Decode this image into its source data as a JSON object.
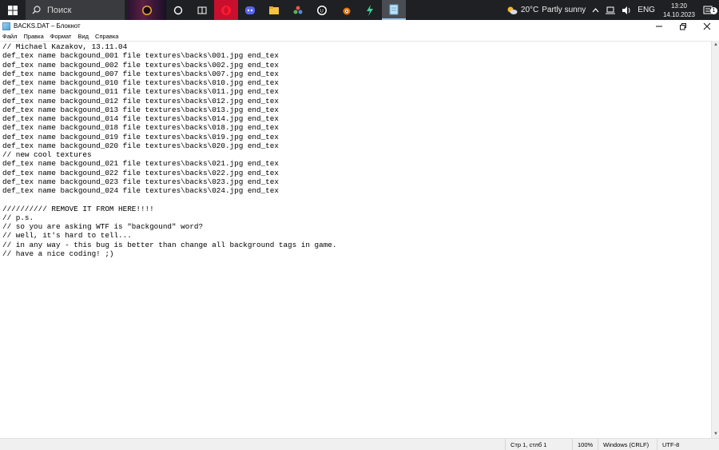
{
  "taskbar": {
    "search_label": "Поиск",
    "weather": {
      "temp": "20°C",
      "condition": "Partly sunny"
    },
    "language": "ENG",
    "time": "13:20",
    "date": "14.10.2023",
    "notification_count": "1",
    "apps": [
      "task-view-icon",
      "widgets-icon",
      "opera-icon",
      "discord-icon",
      "file-explorer-icon",
      "davinci-icon",
      "unreal-engine-icon",
      "blender-icon",
      "app-bolt-icon",
      "notepad-icon"
    ]
  },
  "window": {
    "title": "BACKS.DAT – Блокнот"
  },
  "menu": {
    "file": "Файл",
    "edit": "Правка",
    "format": "Формат",
    "view": "Вид",
    "help": "Справка"
  },
  "editor": {
    "lines": [
      "// Michael Kazakov, 13.11.04",
      "def_tex name backgound_001 file textures\\backs\\001.jpg end_tex",
      "def_tex name backgound_002 file textures\\backs\\002.jpg end_tex",
      "def_tex name backgound_007 file textures\\backs\\007.jpg end_tex",
      "def_tex name backgound_010 file textures\\backs\\010.jpg end_tex",
      "def_tex name backgound_011 file textures\\backs\\011.jpg end_tex",
      "def_tex name backgound_012 file textures\\backs\\012.jpg end_tex",
      "def_tex name backgound_013 file textures\\backs\\013.jpg end_tex",
      "def_tex name backgound_014 file textures\\backs\\014.jpg end_tex",
      "def_tex name backgound_018 file textures\\backs\\018.jpg end_tex",
      "def_tex name backgound_019 file textures\\backs\\019.jpg end_tex",
      "def_tex name backgound_020 file textures\\backs\\020.jpg end_tex",
      "// new cool textures",
      "def_tex name backgound_021 file textures\\backs\\021.jpg end_tex",
      "def_tex name backgound_022 file textures\\backs\\022.jpg end_tex",
      "def_tex name backgound_023 file textures\\backs\\023.jpg end_tex",
      "def_tex name backgound_024 file textures\\backs\\024.jpg end_tex",
      "",
      "////////// REMOVE IT FROM HERE!!!!",
      "// p.s.",
      "// so you are asking WTF is \"backgound\" word?",
      "// well, it's hard to tell...",
      "// in any way - this bug is better than change all background tags in game.",
      "// have a nice coding! ;)"
    ]
  },
  "statusbar": {
    "position": "Стр 1, стлб 1",
    "zoom": "100%",
    "line_ending": "Windows (CRLF)",
    "encoding": "UTF-8"
  }
}
